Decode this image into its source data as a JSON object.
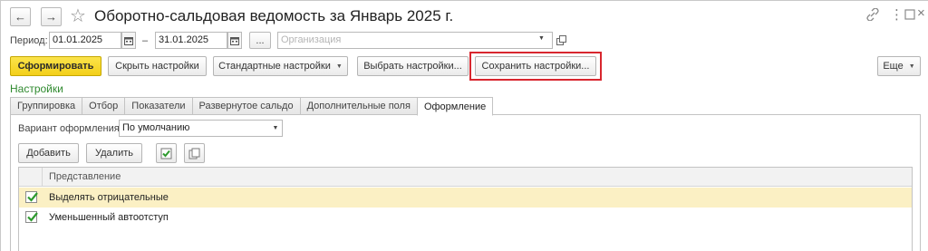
{
  "window": {
    "title": "Оборотно-сальдовая ведомость за Январь 2025 г.",
    "back_icon": "arrow-left-icon",
    "forward_icon": "arrow-right-icon",
    "favorite_icon": "star-icon",
    "link_icon": "link-icon",
    "more_icon": "vertical-dots",
    "maximize_icon": "maximize-icon",
    "close_icon": "close-icon"
  },
  "period": {
    "label": "Период:",
    "from": "01.01.2025",
    "dash": "–",
    "to": "31.01.2025",
    "ellipsis": "...",
    "organization_placeholder": "Организация"
  },
  "toolbar": {
    "generate": "Сформировать",
    "hide_settings": "Скрыть настройки",
    "standard_settings": "Стандартные настройки",
    "choose_settings": "Выбрать настройки...",
    "save_settings": "Сохранить настройки...",
    "more": "Еще"
  },
  "settings": {
    "title": "Настройки",
    "tabs": [
      {
        "label": "Группировка"
      },
      {
        "label": "Отбор"
      },
      {
        "label": "Показатели"
      },
      {
        "label": "Развернутое сальдо"
      },
      {
        "label": "Дополнительные поля"
      },
      {
        "label": "Оформление"
      }
    ],
    "active_tab": "Оформление"
  },
  "design": {
    "variant_label": "Вариант оформления:",
    "variant_value": "По умолчанию",
    "add_button": "Добавить",
    "delete_button": "Удалить",
    "check_all_icon": "check-all-icon",
    "copy_icon": "copy-icon",
    "column_header": "Представление",
    "rows": [
      {
        "label": "Выделять отрицательные",
        "checked": true,
        "selected": true
      },
      {
        "label": "Уменьшенный автоотступ",
        "checked": true,
        "selected": false
      }
    ]
  },
  "colors": {
    "primary_button": "#f5d425",
    "highlight_frame": "#d8262e",
    "section_title": "#2f8a2f",
    "selected_row": "#fbf0c4"
  }
}
